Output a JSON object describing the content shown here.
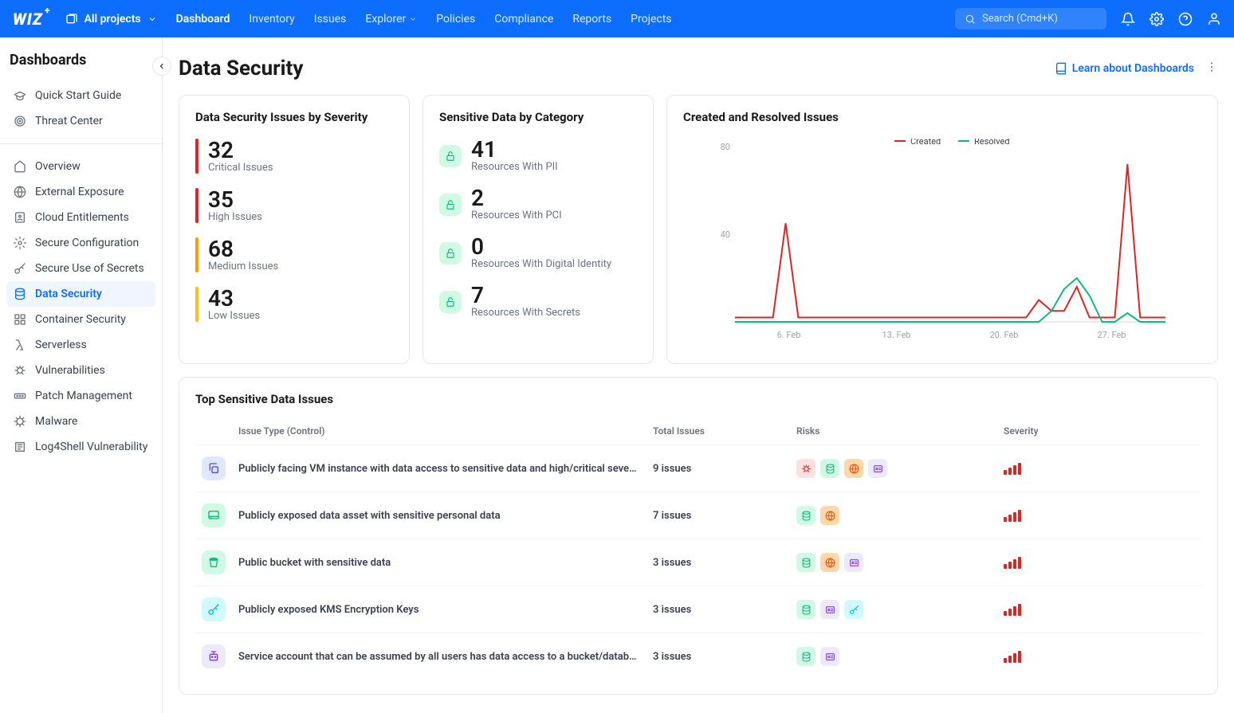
{
  "topbar": {
    "logo": "WIZ",
    "project_selector": "All projects",
    "nav": [
      {
        "label": "Dashboard",
        "active": true
      },
      {
        "label": "Inventory",
        "active": false
      },
      {
        "label": "Issues",
        "active": false
      },
      {
        "label": "Explorer",
        "active": false,
        "dropdown": true
      },
      {
        "label": "Policies",
        "active": false
      },
      {
        "label": "Compliance",
        "active": false
      },
      {
        "label": "Reports",
        "active": false
      },
      {
        "label": "Projects",
        "active": false
      }
    ],
    "search_placeholder": "Search (Cmd+K)"
  },
  "sidebar": {
    "title": "Dashboards",
    "top_items": [
      {
        "label": "Quick Start Guide",
        "icon": "grad-cap"
      },
      {
        "label": "Threat Center",
        "icon": "target"
      }
    ],
    "items": [
      {
        "label": "Overview",
        "icon": "home"
      },
      {
        "label": "External Exposure",
        "icon": "globe"
      },
      {
        "label": "Cloud Entitlements",
        "icon": "badge"
      },
      {
        "label": "Secure Configuration",
        "icon": "gear"
      },
      {
        "label": "Secure Use of Secrets",
        "icon": "key"
      },
      {
        "label": "Data Security",
        "icon": "db",
        "active": true
      },
      {
        "label": "Container Security",
        "icon": "grid"
      },
      {
        "label": "Serverless",
        "icon": "lambda"
      },
      {
        "label": "Vulnerabilities",
        "icon": "bug"
      },
      {
        "label": "Patch Management",
        "icon": "patch"
      },
      {
        "label": "Malware",
        "icon": "virus"
      },
      {
        "label": "Log4Shell Vulnerability",
        "icon": "log"
      }
    ]
  },
  "page": {
    "title": "Data Security",
    "learn_link": "Learn about Dashboards"
  },
  "severity_card": {
    "title": "Data Security Issues by Severity",
    "items": [
      {
        "value": "32",
        "label": "Critical Issues",
        "cls": "sev-critical"
      },
      {
        "value": "35",
        "label": "High Issues",
        "cls": "sev-high"
      },
      {
        "value": "68",
        "label": "Medium Issues",
        "cls": "sev-medium"
      },
      {
        "value": "43",
        "label": "Low Issues",
        "cls": "sev-low"
      }
    ]
  },
  "category_card": {
    "title": "Sensitive Data by Category",
    "items": [
      {
        "value": "41",
        "label": "Resources With PII"
      },
      {
        "value": "2",
        "label": "Resources With PCI"
      },
      {
        "value": "0",
        "label": "Resources With Digital Identity"
      },
      {
        "value": "7",
        "label": "Resources With Secrets"
      }
    ]
  },
  "chart_card": {
    "title": "Created and Resolved Issues",
    "legend": {
      "created": "Created",
      "resolved": "Resolved"
    }
  },
  "chart_data": {
    "type": "line",
    "x_ticks": [
      "6. Feb",
      "13. Feb",
      "20. Feb",
      "27. Feb"
    ],
    "ylim": [
      0,
      80
    ],
    "y_ticks": [
      40,
      80
    ],
    "colors": {
      "Created": "#dc2626",
      "Resolved": "#10b981"
    },
    "series": [
      {
        "name": "Created",
        "values": [
          2,
          2,
          2,
          2,
          45,
          2,
          2,
          2,
          2,
          2,
          2,
          2,
          2,
          2,
          2,
          2,
          2,
          2,
          2,
          2,
          2,
          2,
          2,
          2,
          10,
          5,
          5,
          16,
          2,
          2,
          2,
          72,
          2,
          2,
          2
        ]
      },
      {
        "name": "Resolved",
        "values": [
          0,
          0,
          0,
          0,
          0,
          0,
          0,
          0,
          0,
          0,
          0,
          0,
          0,
          0,
          0,
          0,
          0,
          0,
          0,
          0,
          0,
          0,
          0,
          0,
          0,
          5,
          15,
          20,
          12,
          0,
          0,
          4,
          0,
          0,
          0
        ]
      }
    ]
  },
  "issues_table": {
    "title": "Top Sensitive Data Issues",
    "columns": {
      "type": "Issue Type (Control)",
      "total": "Total Issues",
      "risks": "Risks",
      "severity": "Severity"
    },
    "rows": [
      {
        "icon": "copy",
        "icon_cls": "blue",
        "title": "Publicly facing VM instance with data access to sensitive data and high/critical severity…",
        "total": "9 issues",
        "risks": [
          "bug",
          "db",
          "globe",
          "id"
        ]
      },
      {
        "icon": "drive",
        "icon_cls": "green",
        "title": "Publicly exposed data asset with sensitive personal data",
        "total": "7 issues",
        "risks": [
          "db",
          "globe"
        ]
      },
      {
        "icon": "bucket",
        "icon_cls": "green",
        "title": "Public bucket with sensitive data",
        "total": "3 issues",
        "risks": [
          "db",
          "globe",
          "id"
        ]
      },
      {
        "icon": "key",
        "icon_cls": "cyan",
        "title": "Publicly exposed KMS Encryption Keys",
        "total": "3 issues",
        "risks": [
          "db",
          "id",
          "key"
        ]
      },
      {
        "icon": "robot",
        "icon_cls": "purple",
        "title": "Service account that can be assumed by all users has data access to a bucket/database…",
        "total": "3 issues",
        "risks": [
          "db",
          "id"
        ]
      }
    ]
  }
}
